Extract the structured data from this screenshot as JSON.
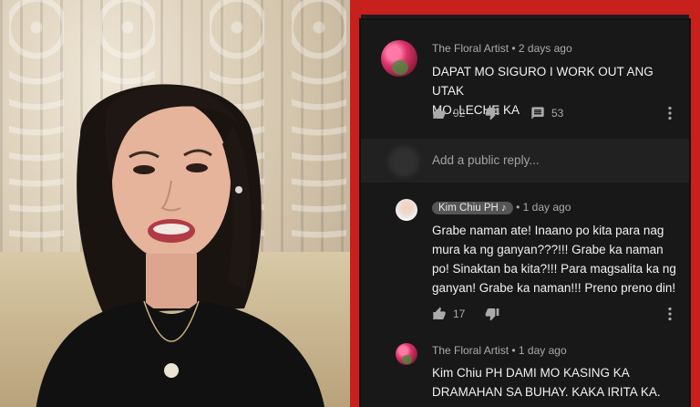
{
  "comment_main": {
    "author": "The Floral Artist",
    "time": "2 days ago",
    "lines": [
      "DAPAT MO SIGURO I WORK OUT ANG UTAK",
      "MO. LECHE KA"
    ],
    "likes": "92",
    "replies": "53"
  },
  "reply_box": {
    "placeholder": "Add a public reply..."
  },
  "reply_kim": {
    "author": "Kim Chiu PH ♪",
    "time": "1 day ago",
    "lines": [
      "Grabe naman ate! Inaano po kita para nag",
      "mura ka ng ganyan???!!! Grabe ka naman",
      "po! Sinaktan ba kita?!!! Para magsalita ka ng",
      "ganyan! Grabe ka naman!!! Preno preno din!"
    ],
    "likes": "17"
  },
  "reply_floral": {
    "author": "The Floral Artist",
    "time": "1 day ago",
    "lines": [
      "Kim Chiu PH DAMI MO KASING KA",
      "DRAMAHAN SA BUHAY. KAKA IRITA KA."
    ]
  },
  "icons": {
    "like": "thumbs-up-icon",
    "dislike": "thumbs-down-icon",
    "reply": "comment-icon",
    "more": "more-vertical-icon"
  },
  "colors": {
    "background_red": "#c8201c",
    "panel_bg": "#181818",
    "reply_box_bg": "#212121",
    "text_primary": "#f1f1f1",
    "text_secondary": "#aaaaaa"
  }
}
